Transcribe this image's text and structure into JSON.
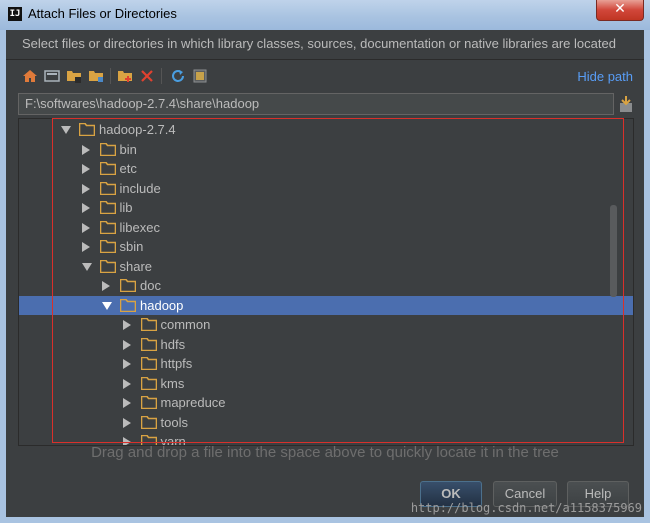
{
  "window": {
    "title": "Attach Files or Directories",
    "app_icon_text": "IJ",
    "close_symbol": "✕"
  },
  "description": "Select files or directories in which library classes, sources, documentation or native libraries are located",
  "toolbar": {
    "buttons": [
      "home-icon",
      "desktop-icon",
      "project-folder-icon",
      "module-folder-icon",
      "new-folder-icon",
      "delete-icon",
      "refresh-icon",
      "show-hidden-icon"
    ],
    "hide_path_label": "Hide path"
  },
  "path": {
    "value": "F:\\softwares\\hadoop-2.7.4\\share\\hadoop"
  },
  "tree": {
    "items": [
      {
        "label": "hadoop-2.7.4",
        "depth": 0,
        "expanded": true,
        "selected": false
      },
      {
        "label": "bin",
        "depth": 1,
        "expanded": false,
        "selected": false
      },
      {
        "label": "etc",
        "depth": 1,
        "expanded": false,
        "selected": false
      },
      {
        "label": "include",
        "depth": 1,
        "expanded": false,
        "selected": false
      },
      {
        "label": "lib",
        "depth": 1,
        "expanded": false,
        "selected": false
      },
      {
        "label": "libexec",
        "depth": 1,
        "expanded": false,
        "selected": false
      },
      {
        "label": "sbin",
        "depth": 1,
        "expanded": false,
        "selected": false
      },
      {
        "label": "share",
        "depth": 1,
        "expanded": true,
        "selected": false
      },
      {
        "label": "doc",
        "depth": 2,
        "expanded": false,
        "selected": false
      },
      {
        "label": "hadoop",
        "depth": 2,
        "expanded": true,
        "selected": true
      },
      {
        "label": "common",
        "depth": 3,
        "expanded": false,
        "selected": false
      },
      {
        "label": "hdfs",
        "depth": 3,
        "expanded": false,
        "selected": false
      },
      {
        "label": "httpfs",
        "depth": 3,
        "expanded": false,
        "selected": false
      },
      {
        "label": "kms",
        "depth": 3,
        "expanded": false,
        "selected": false
      },
      {
        "label": "mapreduce",
        "depth": 3,
        "expanded": false,
        "selected": false
      },
      {
        "label": "tools",
        "depth": 3,
        "expanded": false,
        "selected": false
      },
      {
        "label": "yarn",
        "depth": 3,
        "expanded": false,
        "selected": false
      }
    ]
  },
  "hint": "Drag and drop a file into the space above to quickly locate it in the tree",
  "buttons": {
    "ok": "OK",
    "cancel": "Cancel",
    "help": "Help"
  },
  "watermark": "http://blog.csdn.net/a1158375969",
  "colors": {
    "background": "#3c3f41",
    "selection": "#4b6eaf",
    "link": "#589df6",
    "folder": "#d9a343",
    "annotation_box": "#d9302b"
  }
}
